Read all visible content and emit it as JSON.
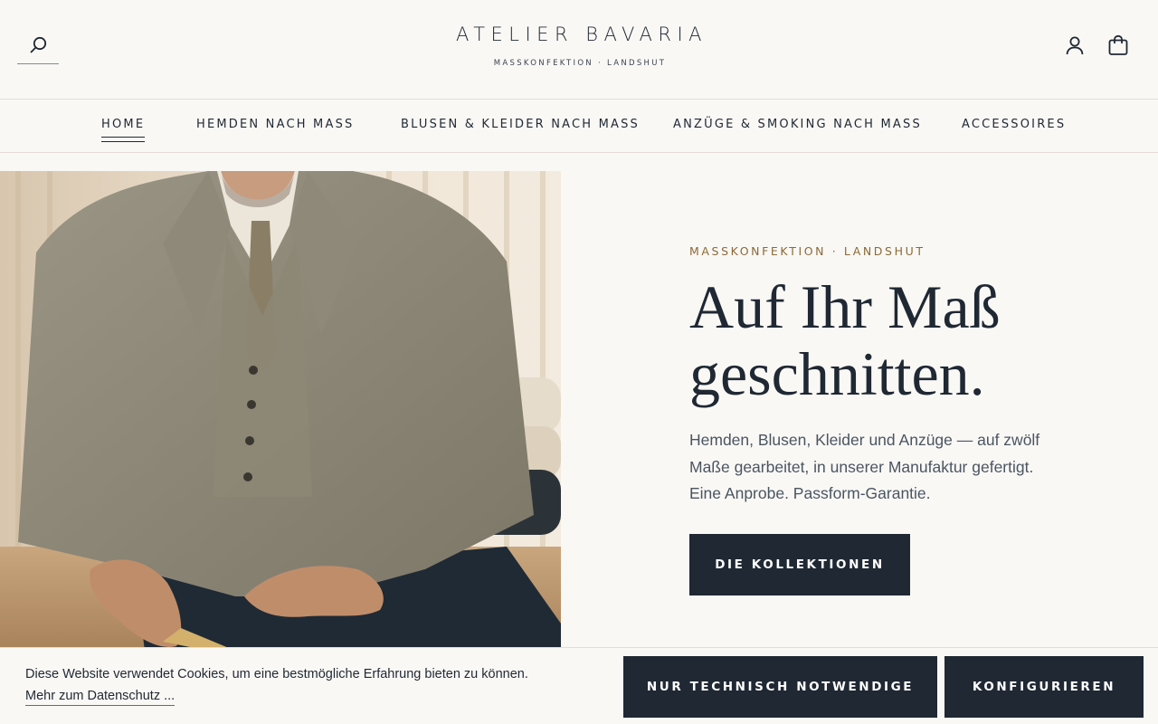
{
  "header": {
    "brand_name": "ATELIER BAVARIA",
    "brand_subtitle": "MASSKONFEKTION · LANDSHUT",
    "icons": [
      "search-icon",
      "account-icon",
      "shopping-bag-icon"
    ]
  },
  "nav": {
    "items": [
      {
        "label": "HOME",
        "active": true
      },
      {
        "label": "HEMDEN NACH MASS",
        "active": false
      },
      {
        "label": "BLUSEN & KLEIDER NACH MASS",
        "active": false
      },
      {
        "label": "ANZÜGE & SMOKING NACH MASS",
        "active": false
      },
      {
        "label": "ACCESSOIRES",
        "active": false
      }
    ]
  },
  "hero": {
    "eyebrow": "MASSKONFEKTION · LANDSHUT",
    "headline_line1": "Auf Ihr Maß",
    "headline_line2": "geschnitten.",
    "body": "Hemden, Blusen, Kleider und Anzüge — auf zwölf Maße gearbeitet, in unserer Manufaktur gefertigt. Eine Anprobe. Passform-Garantie.",
    "cta_label": "DIE KOLLEKTIONEN"
  },
  "cookie": {
    "text": "Diese Website verwendet Cookies, um eine bestmögliche Erfahrung bieten zu können.",
    "link": "Mehr zum Datenschutz ...",
    "necessary_button": "NUR TECHNISCH NOTWENDIGE",
    "configure_button": "KONFIGURIEREN"
  },
  "colors": {
    "background": "#faf8f5",
    "ink": "#1f2833",
    "accent_gold": "#8a6a36",
    "divider": "#e6ddd6"
  }
}
